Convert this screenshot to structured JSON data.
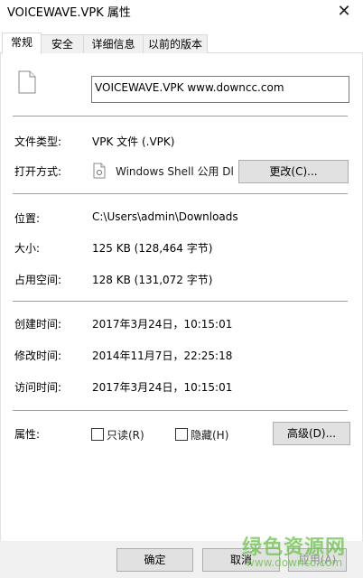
{
  "window": {
    "title": "VOICEWAVE.VPK 属性",
    "close_glyph": "✕"
  },
  "tabs": [
    {
      "label": "常规",
      "active": true
    },
    {
      "label": "安全",
      "active": false
    },
    {
      "label": "详细信息",
      "active": false
    },
    {
      "label": "以前的版本",
      "active": false
    }
  ],
  "general": {
    "filename": "VOICEWAVE.VPK      www.downcc.com",
    "file_type": {
      "label": "文件类型:",
      "value": "VPK 文件 (.VPK)"
    },
    "open_with": {
      "label": "打开方式:",
      "value": "Windows Shell 公用 Dl",
      "button": "更改(C)..."
    },
    "location": {
      "label": "位置:",
      "value": "C:\\Users\\admin\\Downloads"
    },
    "size": {
      "label": "大小:",
      "value": "125 KB (128,464 字节)"
    },
    "size_on_disk": {
      "label": "占用空间:",
      "value": "128 KB (131,072 字节)"
    },
    "created": {
      "label": "创建时间:",
      "value": "2017年3月24日，10:15:01"
    },
    "modified": {
      "label": "修改时间:",
      "value": "2014年11月7日，22:25:18"
    },
    "accessed": {
      "label": "访问时间:",
      "value": "2017年3月24日，10:15:01"
    },
    "attributes": {
      "label": "属性:",
      "readonly": {
        "label": "只读(R)",
        "checked": false
      },
      "hidden": {
        "label": "隐藏(H)",
        "checked": false
      },
      "advanced_button": "高级(D)..."
    }
  },
  "footer": {
    "ok": "确定",
    "cancel": "取消",
    "apply": "应用(A)"
  },
  "watermark": {
    "text": "绿色资源网",
    "url": "www.downcc.com"
  },
  "colors": {
    "button_bg": "#e1e1e1",
    "watermark": "#6cc24a"
  }
}
